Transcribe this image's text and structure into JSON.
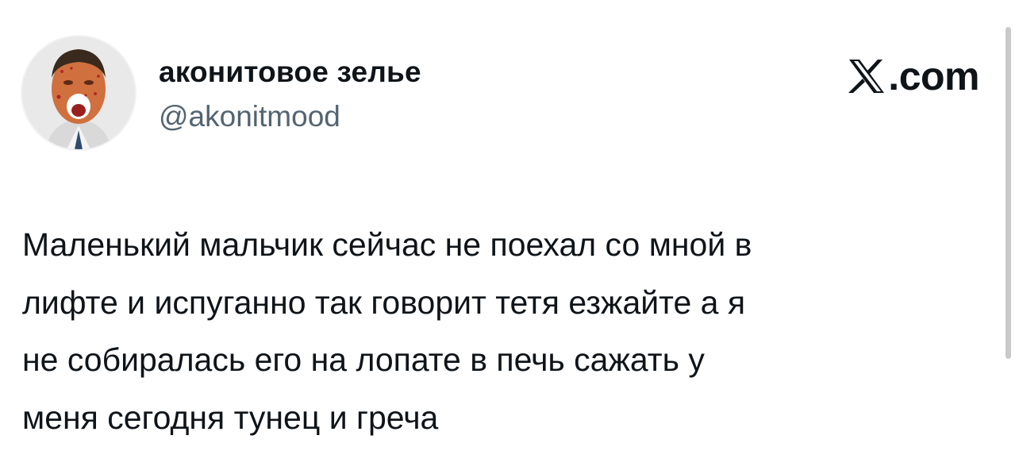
{
  "author": {
    "display_name": "аконитовое зелье",
    "handle": "@akonitmood",
    "avatar": "man-screaming-face-avatar"
  },
  "brand": {
    "icon": "x-logo-icon",
    "text": ".com"
  },
  "tweet": {
    "lines": [
      "Маленький мальчик сейчас не поехал со мной в",
      "лифте и испуганно так говорит тетя езжайте а я",
      "не собиралась его на лопате в печь сажать у",
      "меня сегодня тунец и греча"
    ]
  },
  "colors": {
    "text_primary": "#0f1419",
    "text_secondary": "#536471",
    "background": "#ffffff"
  }
}
